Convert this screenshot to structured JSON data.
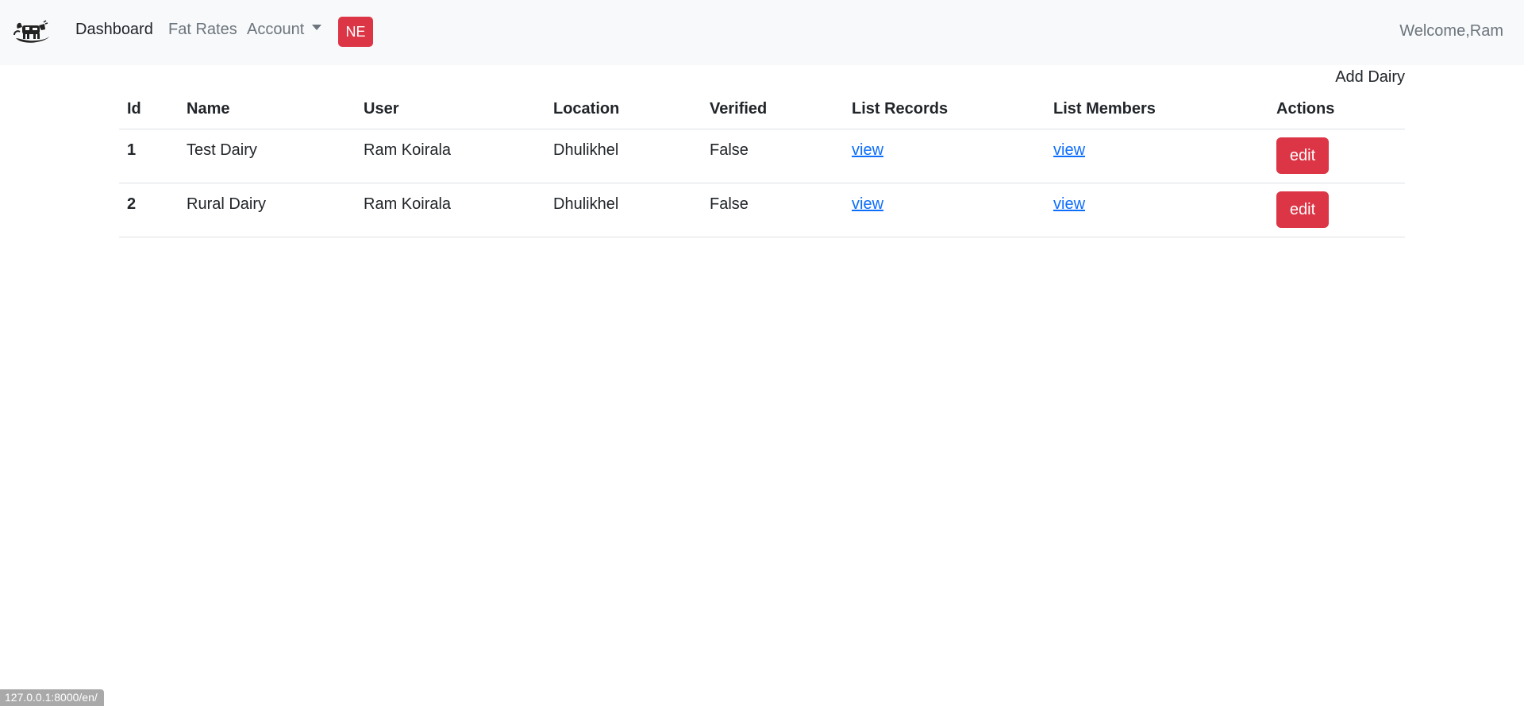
{
  "navbar": {
    "logo_icon": "cow-logo-icon",
    "links": {
      "dashboard": "Dashboard",
      "fat_rates": "Fat Rates",
      "account": "Account"
    },
    "language_button": "NE",
    "welcome_text": "Welcome,Ram"
  },
  "add_dairy_label": "Add Dairy",
  "table": {
    "headers": {
      "id": "Id",
      "name": "Name",
      "user": "User",
      "location": "Location",
      "verified": "Verified",
      "list_records": "List Records",
      "list_members": "List Members",
      "actions": "Actions"
    },
    "rows": [
      {
        "id": "1",
        "name": "Test Dairy",
        "user": "Ram Koirala",
        "location": "Dhulikhel",
        "verified": "False",
        "records_link": "view",
        "members_link": "view",
        "action_label": "edit"
      },
      {
        "id": "2",
        "name": "Rural Dairy",
        "user": "Ram Koirala",
        "location": "Dhulikhel",
        "verified": "False",
        "records_link": "view",
        "members_link": "view",
        "action_label": "edit"
      }
    ]
  },
  "status_bar_url": "127.0.0.1:8000/en/",
  "colors": {
    "navbar_bg": "#f8f9fa",
    "danger": "#dc3545",
    "link": "#0d6efd",
    "muted": "#6c757d"
  }
}
